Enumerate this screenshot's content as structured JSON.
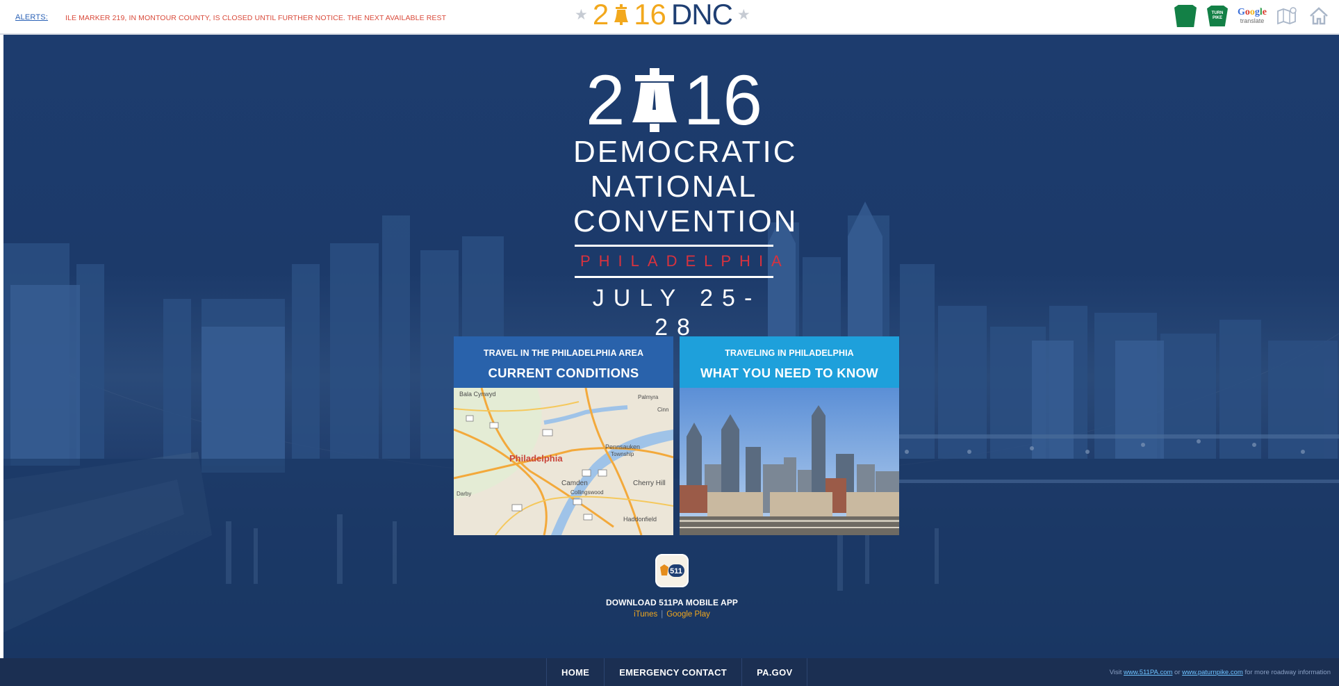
{
  "topbar": {
    "alerts_label": "ALERTS:",
    "ticker_text": "ILE MARKER 219, IN MONTOUR COUNTY, IS CLOSED UNTIL FURTHER NOTICE. THE NEXT AVAILABLE REST",
    "logo": {
      "digit_2": "2",
      "digits_16": "16",
      "brand": "DNC"
    },
    "icons": {
      "keystone": "pa-keystone-icon",
      "turnpike": "pa-turnpike-icon",
      "turnpike_text": "TURN PIKE",
      "google_word": "Google",
      "google_sub": "translate",
      "map": "map-icon",
      "home": "home-icon"
    }
  },
  "hero": {
    "logo": {
      "year_2": "2",
      "year_16": "16",
      "line1": "DEMOCRATIC",
      "line2": "NATIONAL",
      "line3": "CONVENTION",
      "city": "PHILADELPHIA",
      "dates": "JULY 25-28"
    },
    "cards": [
      {
        "subtitle": "TRAVEL IN THE PHILADELPHIA AREA",
        "title": "CURRENT CONDITIONS"
      },
      {
        "subtitle": "TRAVELING IN PHILADELPHIA",
        "title": "WHAT YOU NEED TO KNOW"
      }
    ],
    "map_labels": {
      "bala": "Bala Cynwyd",
      "palmyra": "Palmyra",
      "cinna": "Cinn",
      "phila": "Philadelphia",
      "penn": "Pennsauken",
      "township": "Township",
      "camden": "Camden",
      "cherry": "Cherry Hill",
      "colling": "Collingswood",
      "haddon": "Haddonfield",
      "darby": "Darby"
    },
    "app": {
      "badge": "511",
      "label": "DOWNLOAD 511PA MOBILE APP",
      "itunes": "iTunes",
      "separator": "|",
      "google_play": "Google Play"
    }
  },
  "footer": {
    "nav": [
      "HOME",
      "EMERGENCY CONTACT",
      "PA.GOV"
    ],
    "note_prefix": "Visit",
    "note_link1": "www.511PA.com",
    "note_or": "or",
    "note_link2": "www.paturnpike.com",
    "note_suffix": "for more roadway information"
  },
  "colors": {
    "hero_bg": "#1d3c6e",
    "card1_head": "#2962ab",
    "card2_head": "#1ea0db",
    "accent_gold": "#f2a81d",
    "philadelphia_red": "#d8323e",
    "ticker_red": "#d94a3a",
    "footer_bg": "#1b2f52"
  }
}
